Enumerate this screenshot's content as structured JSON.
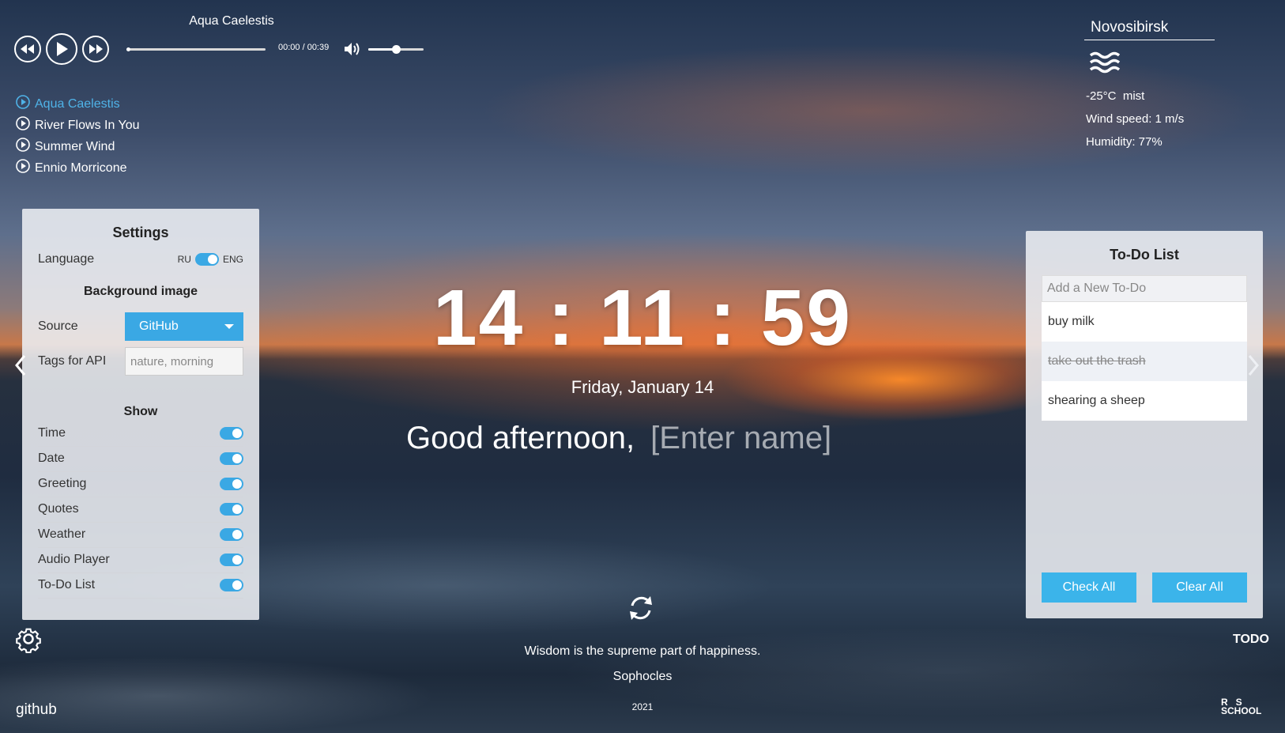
{
  "player": {
    "current_track": "Aqua Caelestis",
    "time": "00:00 / 00:39",
    "volume": 0.5,
    "playlist": [
      {
        "title": "Aqua Caelestis",
        "active": true
      },
      {
        "title": "River Flows In You",
        "active": false
      },
      {
        "title": "Summer Wind",
        "active": false
      },
      {
        "title": "Ennio Morricone",
        "active": false
      }
    ]
  },
  "weather": {
    "city": "Novosibirsk",
    "icon": "mist-icon",
    "temp_desc": "-25°C  mist",
    "wind": "Wind speed: 1 m/s",
    "humidity": "Humidity: 77%"
  },
  "settings": {
    "title": "Settings",
    "language_label": "Language",
    "lang_ru": "RU",
    "lang_eng": "ENG",
    "bg_heading": "Background image",
    "source_label": "Source",
    "source_value": "GitHub",
    "tags_label": "Tags for API",
    "tags_placeholder": "nature, morning",
    "show_heading": "Show",
    "show_items": [
      "Time",
      "Date",
      "Greeting",
      "Quotes",
      "Weather",
      "Audio Player",
      "To-Do List"
    ]
  },
  "clock": {
    "time": "14 : 11 : 59",
    "date": "Friday, January 14",
    "greeting": "Good afternoon,",
    "name_placeholder": "[Enter name]"
  },
  "quote": {
    "text": "Wisdom is the supreme part of happiness.",
    "author": "Sophocles"
  },
  "todo": {
    "title": "To-Do List",
    "placeholder": "Add a New To-Do",
    "items": [
      {
        "text": "buy milk",
        "done": false
      },
      {
        "text": "take out the trash",
        "done": true
      },
      {
        "text": "shearing a sheep",
        "done": false
      }
    ],
    "check_all": "Check All",
    "clear_all": "Clear All",
    "toggle_label": "TODO"
  },
  "footer": {
    "github": "github",
    "year": "2021",
    "logo_line1": "R   S",
    "logo_line2": "SCHOOL"
  },
  "colors": {
    "accent": "#3aa8e4",
    "active_track": "#4fb3e8"
  }
}
